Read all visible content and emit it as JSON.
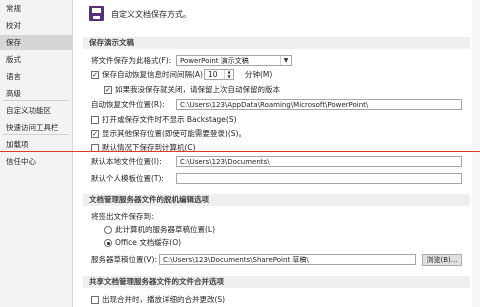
{
  "sidebar": {
    "items": [
      {
        "label": "常规"
      },
      {
        "label": "校对"
      },
      {
        "label": "保存"
      },
      {
        "label": "版式"
      },
      {
        "label": "语言"
      },
      {
        "label": "高级"
      },
      {
        "label": "自定义功能区"
      },
      {
        "label": "快速访问工具栏"
      },
      {
        "label": "加载项"
      },
      {
        "label": "信任中心"
      }
    ]
  },
  "header": {
    "title": "自定义文档保存方式。"
  },
  "save_section": {
    "title": "保存演示文稿",
    "format_label": "将文件保存为此格式(F):",
    "format_value": "PowerPoint 演示文稿",
    "autorecover_label": "保存自动恢复信息时间间隔(A)",
    "autorecover_minutes": "10",
    "minutes_unit": "分钟(M)",
    "keep_last_label": "如果我没保存就关闭，请保留上次自动保留的版本",
    "autorecover_location_label": "自动恢复文件位置(R):",
    "autorecover_location_value": "C:\\Users\\123\\AppData\\Roaming\\Microsoft\\PowerPoint\\",
    "no_backstage_label": "打开或保存文件时不显示 Backstage(S)",
    "show_other_locations_label": "显示其他保存位置(即使可能需要登录)(S)。",
    "save_to_computer_label": "默认情况下保存到计算机(C)",
    "default_local_label": "默认本地文件位置(I):",
    "default_local_value": "C:\\Users\\123\\Documents\\",
    "personal_templates_label": "默认个人模板位置(T):",
    "personal_templates_value": ""
  },
  "offline_section": {
    "title": "文档管理服务器文件的脱机编辑选项",
    "save_checked_out_label": "将签出文件保存到:",
    "radio_server_label": "此计算机的服务器草稿位置(L)",
    "radio_office_cache_label": "Office 文档缓存(O)",
    "server_drafts_label": "服务器草稿位置(V):",
    "server_drafts_value": "C:\\Users\\123\\Documents\\SharePoint 草稿\\",
    "browse_button": "浏览(B)..."
  },
  "merge_section": {
    "title": "共享文档管理服务器文件的文件合并选项",
    "merge_detail_label": "出现合并时，播放详细的合并更改(S)"
  },
  "colors": {
    "accent": "#5b2e7a",
    "annotation_line": "#e0392b"
  }
}
